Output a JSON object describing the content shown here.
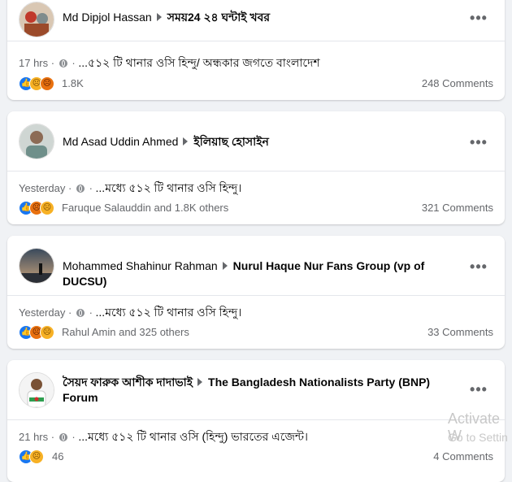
{
  "posts": [
    {
      "author": "Md Dipjol Hassan",
      "group": "সময়24 ২৪ ঘন্টাই খবর",
      "time": "17 hrs",
      "snippet": "...৫১২ টি থানার ওসি হিন্দু/ অন্ধকার জগতে বাংলাদেশ",
      "reactions_text": "1.8K",
      "reaction_icons": [
        "like",
        "sad",
        "angry"
      ],
      "comments": "248 Comments"
    },
    {
      "author": "Md Asad Uddin Ahmed",
      "group": "ইলিয়াছ হোসাইন",
      "time": "Yesterday",
      "snippet": "...মধ্যে ৫১২ টি থানার ওসি হিন্দু।",
      "reactions_text": "Faruque Salauddin and 1.8K others",
      "reaction_icons": [
        "like",
        "angry",
        "sad"
      ],
      "comments": "321 Comments"
    },
    {
      "author": "Mohammed Shahinur Rahman",
      "group": "Nurul Haque Nur Fans Group (vp of DUCSU)",
      "time": "Yesterday",
      "snippet": "...মধ্যে ৫১২ টি থানার ওসি হিন্দু।",
      "reactions_text": "Rahul Amin and 325 others",
      "reaction_icons": [
        "like",
        "angry",
        "sad"
      ],
      "comments": "33 Comments"
    },
    {
      "author": "সৈয়দ ফারুক আশীক দাদাভাই",
      "group": "The Bangladesh Nationalists Party (BNP) Forum",
      "time": "21 hrs",
      "snippet": "...মধ্যে ৫১২ টি থানার ওসি (হিন্দু) ভারতের এজেন্ট।",
      "reactions_text": "46",
      "reaction_icons": [
        "like",
        "sad"
      ],
      "comments": "4 Comments"
    }
  ],
  "ui": {
    "more_glyph": "•••",
    "separator": "·"
  },
  "watermark": {
    "line1": "Activate W",
    "line2": "Go to Settin"
  }
}
